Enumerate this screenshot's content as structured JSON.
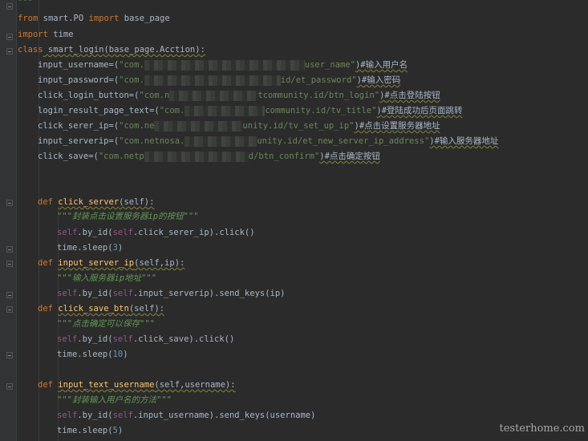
{
  "code": {
    "top": "\"\"\"",
    "imp1_from": "from",
    "imp1_mod": " smart.PO ",
    "imp1_import": "import",
    "imp1_name": " base_page",
    "imp2_import": "import",
    "imp2_name": " time",
    "cls_kw": "class",
    "cls_rest": " smart_login(base_page.Acction):",
    "rows": [
      {
        "name": "input_username=(",
        "s1": "\"com.",
        "s2": "user_name\"",
        "tail": ")#输入用户名"
      },
      {
        "name": "input_password=(",
        "s1": "\"com.",
        "s2": "id/et_password\"",
        "tail": ")#输入密码"
      },
      {
        "name": "click_login_button=(",
        "s1": "\"com.n",
        "s2": "tcommunity.id/btn_login\"",
        "tail": ")#点击登陆按钮"
      },
      {
        "name": "login_result_page_text=(",
        "s1": "\"com.",
        "s2": "community.id/tv_title\"",
        "tail": ")#登陆成功后页面跳转"
      },
      {
        "name": "click_serer_ip=(",
        "s1": "\"com.ne",
        "s2": "unity.id/tv_set_up_ip\"",
        "tail": ")#点击设置服务器地址"
      },
      {
        "name": "input_serverip=(",
        "s1": "\"com.netnosa.",
        "s2": "unity.id/et_new_server_ip_address\"",
        "tail": ")#输入服务器地址"
      },
      {
        "name": "click_save=(",
        "s1": "\"com.netp",
        "s2": "d/btn_confirm\"",
        "tail": ")#点击确定按钮"
      }
    ],
    "def_kw": "def",
    "m1_name": "click_server",
    "m1_args": "(self):",
    "m1_doc": "\"\"\"封装点击设置服务器ip的按钮\"\"\"",
    "m1_b1a": ".by_id(",
    "m1_b1b": ".click_serer_ip).click()",
    "m1_b2": "time.sleep(",
    "m1_b2n": "3",
    "m2_name": "input_server_ip",
    "m2_args": "(self,ip):",
    "m2_doc": "\"\"\"输入服务器ip地址\"\"\"",
    "m2_b1b": ".input_serverip).send_keys(ip)",
    "m3_name": "click_save_btn",
    "m3_args": "(self):",
    "m3_doc": "\"\"\"点击确定可以保存\"\"\"",
    "m3_b1b": ".click_save).click()",
    "m3_b2n": "10",
    "m4_name": "input_text_username",
    "m4_args": "(self,username):",
    "m4_doc": "\"\"\"封装输入用户名的方法\"\"\"",
    "m4_b1b": ".input_username).send_keys(username)",
    "m4_b2n": "5",
    "self": "self",
    "close": ")"
  },
  "watermark": "testerhome.com"
}
